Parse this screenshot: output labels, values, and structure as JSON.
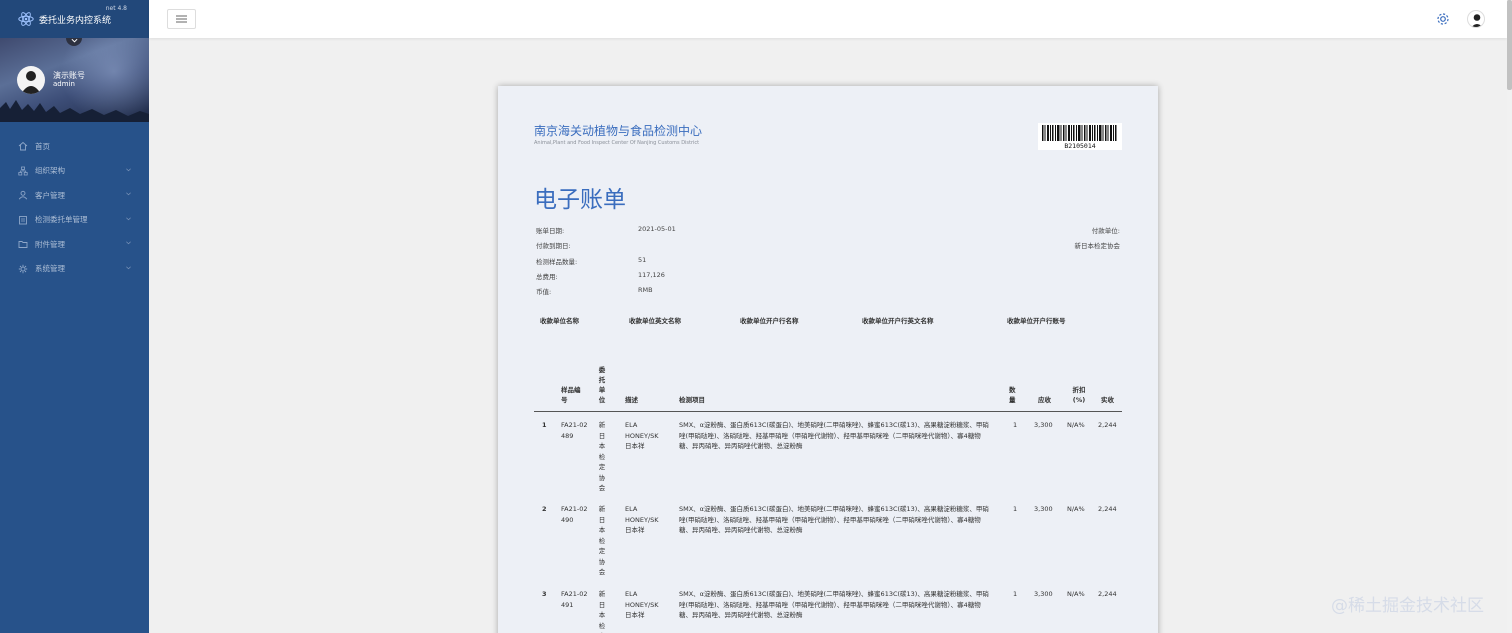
{
  "app": {
    "title": "委托业务内控系统",
    "version": "net 4.8"
  },
  "user": {
    "name": "演示账号",
    "role": "admin"
  },
  "sidebar": {
    "items": [
      {
        "label": "首页",
        "icon": "home-icon",
        "has_children": false
      },
      {
        "label": "组织架构",
        "icon": "org-icon",
        "has_children": true
      },
      {
        "label": "客户管理",
        "icon": "user-icon",
        "has_children": true
      },
      {
        "label": "检测委托单管理",
        "icon": "clipboard-icon",
        "has_children": true
      },
      {
        "label": "附件管理",
        "icon": "folder-icon",
        "has_children": true
      },
      {
        "label": "系统管理",
        "icon": "gear-icon",
        "has_children": true
      }
    ]
  },
  "document": {
    "org_cn": "南京海关动植物与食品检测中心",
    "org_en": "Animal,Plant and Food Inspect Center Of Nanjing Customs District",
    "barcode_text": "B2105014",
    "title": "电子账单",
    "info": [
      {
        "label": "账单日期:",
        "value": "2021-05-01"
      },
      {
        "label": "付款到期日:",
        "value": ""
      },
      {
        "label": "检测样品数量:",
        "value": "51"
      },
      {
        "label": "总费用:",
        "value": "117,126"
      },
      {
        "label": "币值:",
        "value": "RMB"
      }
    ],
    "payer_label": "付款单位:",
    "payer_value": "新日本检定协会",
    "bank_headers": [
      "收款单位名称",
      "收款单位英文名称",
      "收款单位开户行名称",
      "收款单位开户行英文名称",
      "收款单位开户行账号"
    ],
    "table_headers": {
      "sample_no": "样品编号",
      "client": "委托单位",
      "desc": "描述",
      "items": "检测项目",
      "qty": "数量",
      "due": "应收",
      "discount": "折扣(%)",
      "actual": "实收"
    },
    "rows": [
      {
        "idx": "1",
        "sample_no": "FA21-02489",
        "client": "新日本检定协会",
        "desc": "ELA HONEY/SK 日本祥",
        "items": "SMX、α淀粉酶、蛋白质613C(碳蛋白)、地美硝唑(二甲硝咪唑)、蜂蜜613C(碳13)、高果糖淀粉糖浆、甲硝唑(甲硝哒唑)、洛硝哒唑、羟基甲硝唑（甲硝唑代谢物）、羟甲基甲硝咪唑（二甲硝咪唑代谢物）、寡4糖物糖、异丙硝唑、异丙硝唑代谢物、总淀粉酶",
        "qty": "1",
        "due": "3,300",
        "discount": "N/A%",
        "actual": "2,244"
      },
      {
        "idx": "2",
        "sample_no": "FA21-02490",
        "client": "新日本检定协会",
        "desc": "ELA HONEY/SK 日本祥",
        "items": "SMX、α淀粉酶、蛋白质613C(碳蛋白)、地美硝唑(二甲硝咪唑)、蜂蜜613C(碳13)、高果糖淀粉糖浆、甲硝唑(甲硝哒唑)、洛硝哒唑、羟基甲硝唑（甲硝唑代谢物）、羟甲基甲硝咪唑（二甲硝咪唑代谢物）、寡4糖物糖、异丙硝唑、异丙硝唑代谢物、总淀粉酶",
        "qty": "1",
        "due": "3,300",
        "discount": "N/A%",
        "actual": "2,244"
      },
      {
        "idx": "3",
        "sample_no": "FA21-02491",
        "client": "新日本检定协会",
        "desc": "ELA HONEY/SK 日本祥",
        "items": "SMX、α淀粉酶、蛋白质613C(碳蛋白)、地美硝唑(二甲硝咪唑)、蜂蜜613C(碳13)、高果糖淀粉糖浆、甲硝唑(甲硝哒唑)、洛硝哒唑、羟基甲硝唑（甲硝唑代谢物）、羟甲基甲硝咪唑（二甲硝咪唑代谢物）、寡4糖物糖、异丙硝唑、异丙硝唑代谢物、总淀粉酶",
        "qty": "1",
        "due": "3,300",
        "discount": "N/A%",
        "actual": "2,244"
      }
    ]
  },
  "watermark": "@稀土掘金技术社区",
  "colors": {
    "sidebar": "#27528a",
    "accent": "#3a6dbe",
    "paper": "#edf0f6"
  }
}
